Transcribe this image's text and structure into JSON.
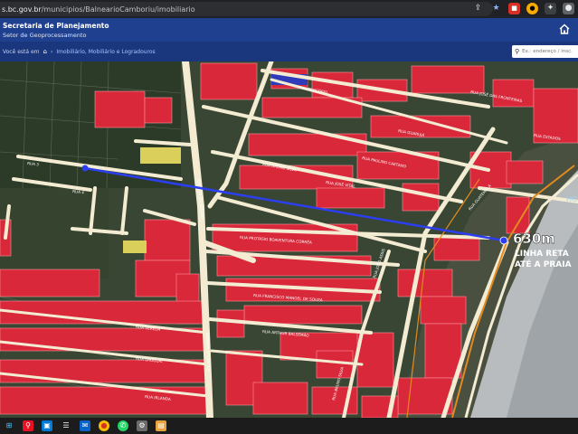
{
  "browser": {
    "url_host": "s.bc.gov.br",
    "url_path": "/municipios/BalnearioCamboriu/imobiliario",
    "icons": [
      "share-icon",
      "star-icon",
      "extension-icon",
      "extension-icon",
      "puzzle-icon",
      "profile-icon"
    ]
  },
  "header": {
    "title": "Secretaria de Planejamento",
    "subtitle": "Setor de Geoprocessamento",
    "breadcrumb_prefix": "Você está em",
    "breadcrumb_current": "Imobiliário, Mobiliário e Logradouros",
    "search_placeholder": "Ex.: endereço / insc. imob."
  },
  "map": {
    "streets": [
      "RUA BRUNO SILVA",
      "RUA PAULINO CAETANO",
      "RUA PROTÁSIO BOAVENTURA CORRÊA",
      "RUA FRANCISCO MANOEL DE SOUZA",
      "RUA ARTHUR BALSEMÃO",
      "RUA VEREDA",
      "RUA URUGUAI",
      "RUA IRLANDA",
      "RUA GUARUJÁ",
      "RUA JOSÉ DAS FRONTEIRAS",
      "RUA ESTADOS",
      "RUA PROCÓPIO",
      "RUA JOSÉ VITAL",
      "RUA GUATEMALA",
      "RUA JOÃO ASSIS",
      "AVENIDA DO ESTADO",
      "AVENIDA ATLÂNTICA",
      "RUA 4",
      "RUA 3",
      "RUA BRUNO SILVA"
    ],
    "annotation_distance": "630m",
    "annotation_line1": "LINHA RETA",
    "annotation_line2": "ATÉ A PRAIA",
    "side_label": "HO ML"
  },
  "colors": {
    "lot_fill": "#d8283a",
    "road": "#f3ecd2",
    "distance_line": "#2b3ff0",
    "header": "#1f3f8f",
    "sea": "#b8bcbe"
  },
  "taskbar": {
    "apps": [
      "windows-icon",
      "search-icon",
      "task-view-icon",
      "file-explorer-icon",
      "mail-icon",
      "chrome-icon",
      "whatsapp-icon",
      "settings-icon",
      "photos-icon"
    ]
  }
}
